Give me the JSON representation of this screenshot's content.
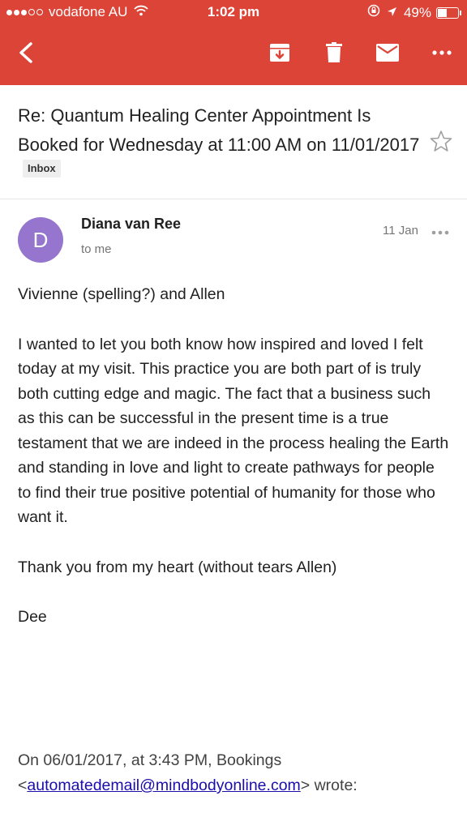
{
  "status_bar": {
    "carrier": "vodafone AU",
    "time": "1:02 pm",
    "battery": "49%",
    "battery_level": 0.49
  },
  "toolbar": {
    "back_icon": "back-arrow-icon",
    "archive_icon": "archive-icon",
    "delete_icon": "trash-icon",
    "mark_unread_icon": "mail-icon",
    "more_icon": "more-horizontal-icon",
    "color": "#db4437"
  },
  "email": {
    "subject": "Re: Quantum Healing Center Appointment Is Booked for Wednesday at 11:00 AM on 11/01/2017",
    "label": "Inbox",
    "sender_initial": "D",
    "sender_name": "Diana van Ree",
    "recipient": "to me",
    "date": "11 Jan",
    "avatar_color": "#9575cd",
    "body": [
      "Vivienne (spelling?) and Allen",
      "I wanted to let you both know how inspired and loved I felt today at my visit. This practice you are both part of is truly both cutting edge and magic. The fact that a business such as this can be successful in the present time is a true testament that we are indeed in the process healing the Earth and standing in love and light to create pathways for people to find their true positive potential of humanity for those who want it.",
      "Thank you from my heart (without tears Allen)",
      "Dee"
    ],
    "quote_header_1": "On 06/01/2017, at 3:43 PM, Bookings",
    "quote_email": "automatedemail@mindbodyonline.com",
    "quote_lt": "<",
    "quote_suffix": "> wrote:"
  }
}
